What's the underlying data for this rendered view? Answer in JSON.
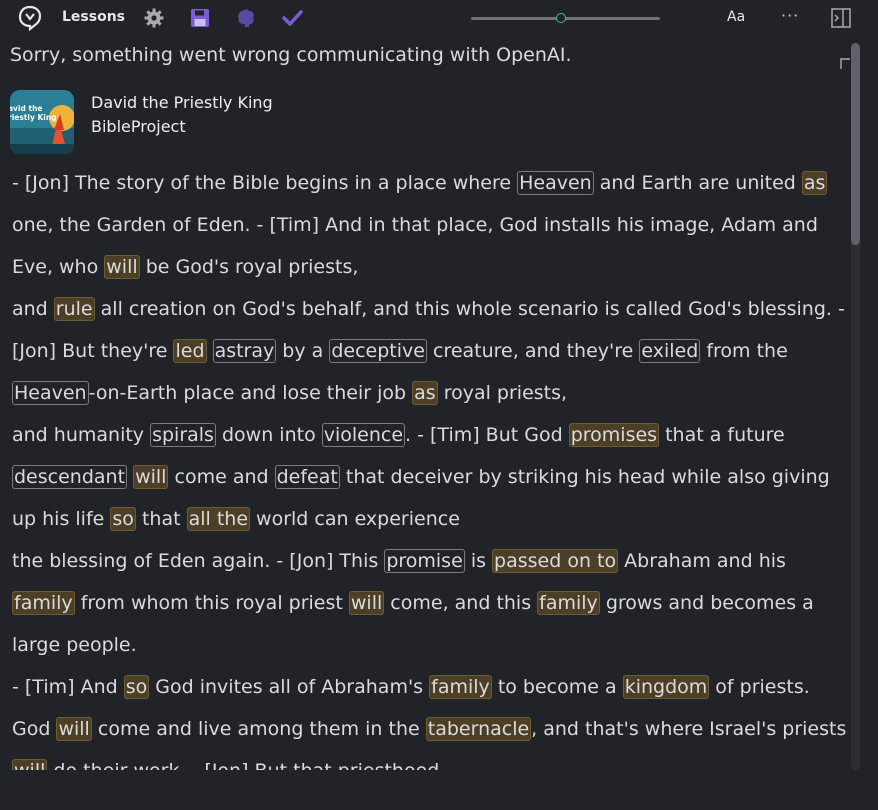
{
  "toolbar": {
    "title": "Lessons",
    "font_label": "Aa",
    "more_label": "···",
    "icons": [
      "logo-icon",
      "gear-icon",
      "save-icon",
      "brain-icon",
      "check-icon",
      "panel-toggle-icon"
    ],
    "slider_value": 0.45,
    "colors": {
      "accent": "#49c16a",
      "check": "#7b5cd6"
    }
  },
  "error": {
    "message": "Sorry, something went wrong communicating with OpenAI."
  },
  "video": {
    "title": "David the Priestly King",
    "channel": "BibleProject",
    "thumbnail_text": "avid the\nriestly King"
  },
  "transcript": {
    "paragraphs": [
      [
        {
          "t": "- [Jon] The story of the Bible begins in a place where "
        },
        {
          "t": "Heaven",
          "hl": "outline"
        },
        {
          "t": " and Earth are united "
        },
        {
          "t": "as",
          "hl": "filled"
        },
        {
          "t": " one, the Garden of Eden. - [Tim] And in that place, God installs his image, Adam and Eve, who "
        },
        {
          "t": "will",
          "hl": "filled"
        },
        {
          "t": " be God's royal priests,"
        }
      ],
      [
        {
          "t": "and "
        },
        {
          "t": "rule",
          "hl": "filled"
        },
        {
          "t": " all creation on God's behalf, and this whole scenario is called God's blessing. - [Jon] But they're "
        },
        {
          "t": "led",
          "hl": "filled"
        },
        {
          "t": " "
        },
        {
          "t": "astray",
          "hl": "outline"
        },
        {
          "t": " by a "
        },
        {
          "t": "deceptive",
          "hl": "outline"
        },
        {
          "t": " creature, and they're "
        },
        {
          "t": "exiled",
          "hl": "outline"
        },
        {
          "t": " from the "
        },
        {
          "t": "Heaven",
          "hl": "outline"
        },
        {
          "t": "-on-Earth place and lose their job "
        },
        {
          "t": "as",
          "hl": "filled"
        },
        {
          "t": " royal priests,"
        }
      ],
      [
        {
          "t": "and humanity "
        },
        {
          "t": "spirals",
          "hl": "outline"
        },
        {
          "t": " down into "
        },
        {
          "t": "violence",
          "hl": "outline"
        },
        {
          "t": ". - [Tim] But God "
        },
        {
          "t": "promises",
          "hl": "filled"
        },
        {
          "t": " that a future "
        },
        {
          "t": "descendant",
          "hl": "outline"
        },
        {
          "t": " "
        },
        {
          "t": "will",
          "hl": "filled"
        },
        {
          "t": " come and "
        },
        {
          "t": "defeat",
          "hl": "outline"
        },
        {
          "t": " that deceiver by striking his head while also giving up his life "
        },
        {
          "t": "so",
          "hl": "filled"
        },
        {
          "t": " that "
        },
        {
          "t": "all the",
          "hl": "filled"
        },
        {
          "t": " world can experience"
        }
      ],
      [
        {
          "t": "the blessing of Eden again. - [Jon] This "
        },
        {
          "t": "promise",
          "hl": "outline"
        },
        {
          "t": " is "
        },
        {
          "t": "passed on to",
          "hl": "filled"
        },
        {
          "t": " Abraham and his "
        },
        {
          "t": "family",
          "hl": "filled"
        },
        {
          "t": " from whom this royal priest "
        },
        {
          "t": "will",
          "hl": "filled"
        },
        {
          "t": " come, and this "
        },
        {
          "t": "family",
          "hl": "filled"
        },
        {
          "t": " grows and becomes a large people."
        }
      ],
      [
        {
          "t": "- [Tim] And "
        },
        {
          "t": "so",
          "hl": "filled"
        },
        {
          "t": " God invites all of Abraham's "
        },
        {
          "t": "family",
          "hl": "filled"
        },
        {
          "t": " to become a "
        },
        {
          "t": "kingdom",
          "hl": "filled"
        },
        {
          "t": " of priests. God "
        },
        {
          "t": "will",
          "hl": "filled"
        },
        {
          "t": " come and live among them in the "
        },
        {
          "t": "tabernacle",
          "hl": "filled"
        },
        {
          "t": ", and that's where Israel's priests "
        },
        {
          "t": "will",
          "hl": "filled"
        },
        {
          "t": " do their work. - [Jon] But that priesthood"
        }
      ]
    ]
  }
}
